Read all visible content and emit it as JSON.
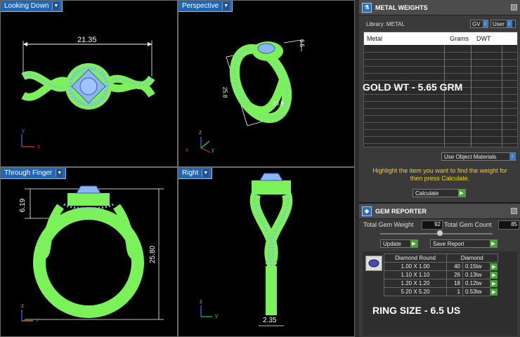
{
  "viewports": {
    "top_left": {
      "label": "Looking Down",
      "dim": "21.35"
    },
    "top_right": {
      "label": "Perspective",
      "dim_a": "6.5",
      "dim_b": "25.8",
      "dim_c": "23.9"
    },
    "bottom_left": {
      "label": "Through Finger",
      "dim_top": "6.19",
      "dim_side": "25.80"
    },
    "bottom_right": {
      "label": "Right",
      "dim_bottom": "2.35"
    }
  },
  "metal_weights": {
    "title": "METAL WEIGHTS",
    "library_label": "Library: METAL",
    "gv_label": "GV",
    "user_label": "User",
    "columns": [
      "Metal",
      "Grams",
      "DWT"
    ],
    "use_object_materials": "Use Object Materials",
    "instruction": "Highlight the item you want to find the weight for then press Calculate.",
    "calculate_option": "Calculate",
    "overlay_gold": "GOLD WT - 5.65 GRM"
  },
  "gem_reporter": {
    "title": "GEM REPORTER",
    "total_weight_label": "Total Gem Weight",
    "total_weight_value": "92",
    "total_count_label": "Total Gem Count",
    "total_count_value": "85",
    "update_label": "Update",
    "save_report_label": "Save Report",
    "table_headers": [
      "Diamond Round",
      "Diamond"
    ],
    "rows": [
      {
        "size": "1.00 X 1.00",
        "count": "40",
        "tw": "0.15tw"
      },
      {
        "size": "1.10 X 1.10",
        "count": "26",
        "tw": "0.13tw"
      },
      {
        "size": "1.20 X 1.20",
        "count": "18",
        "tw": "0.12tw"
      },
      {
        "size": "5.20 X 5.20",
        "count": "1",
        "tw": "0.53tw"
      }
    ],
    "overlay_ring": "RING SIZE - 6.5 US"
  },
  "colors": {
    "metal_green": "#7CF25A",
    "gem_blue": "#8AB6F5",
    "tab_blue": "#1d66b8",
    "overlay_white": "#ffffff",
    "instruction_yellow": "#f2d21a"
  }
}
